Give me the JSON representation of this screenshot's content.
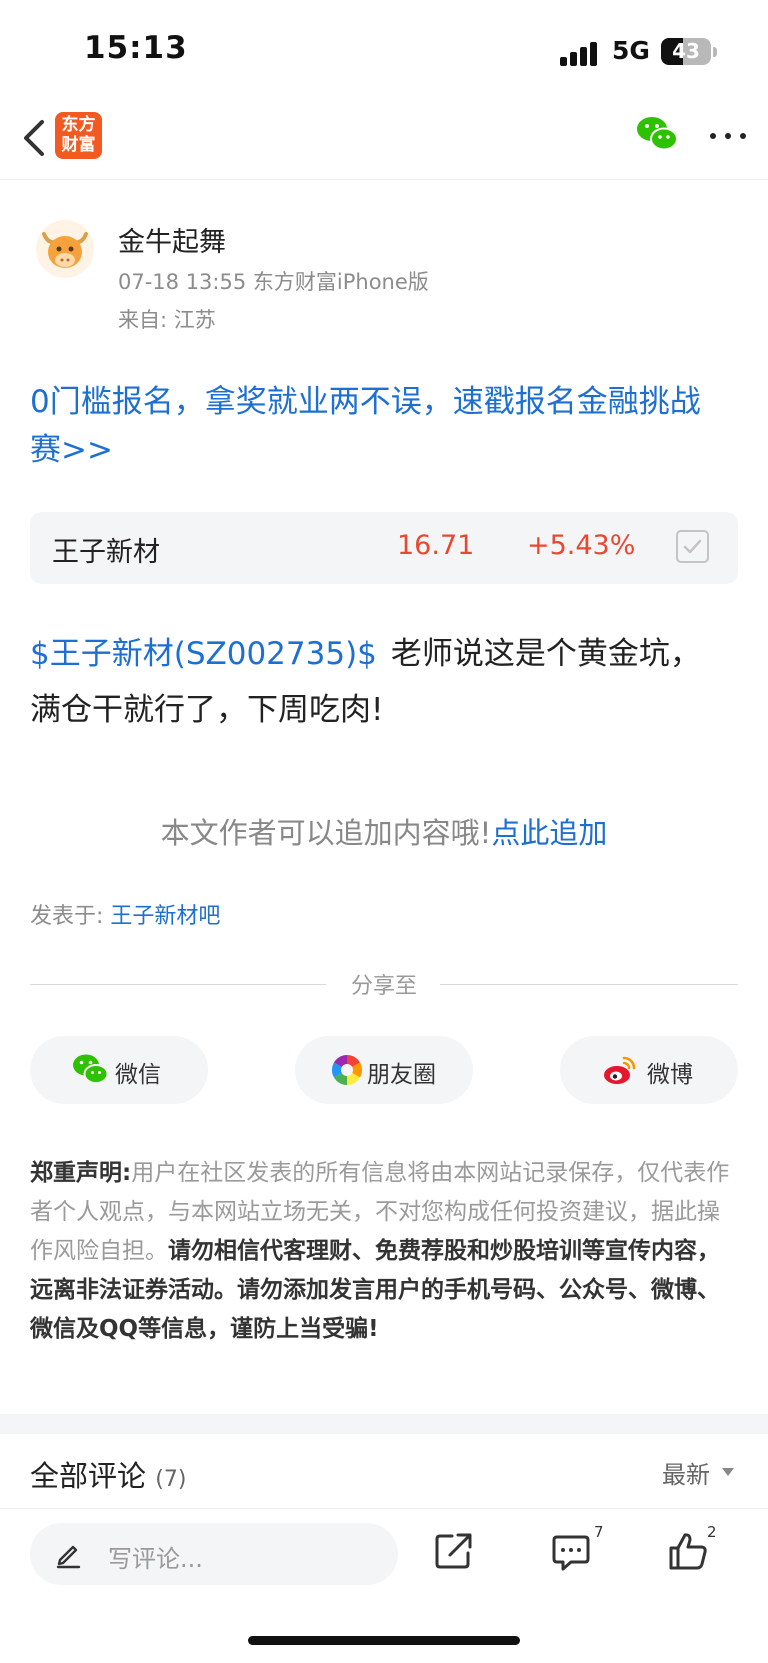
{
  "status_bar": {
    "time": "15:13",
    "network": "5G",
    "battery_level": "43",
    "signal_icon": "signal-bars-icon"
  },
  "nav": {
    "back_icon": "chevron-left-icon",
    "logo_line1": "东方",
    "logo_line2": "财富",
    "share_icon": "wechat-icon",
    "more_icon": "more-dots-icon"
  },
  "author": {
    "name": "金牛起舞",
    "meta": "07-18 13:55 东方财富iPhone版",
    "location": "来自: 江苏",
    "avatar_icon": "bull-avatar-icon"
  },
  "promo": {
    "text": "0门槛报名，拿奖就业两不误，速戳报名金融挑战赛>>"
  },
  "stock": {
    "name": "王子新材",
    "price": "16.71",
    "change": "+5.43%",
    "add_icon": "checkbox-icon"
  },
  "post": {
    "mention": "$王子新材(SZ002735)$",
    "body": "老师说这是个黄金坑，满仓干就行了，下周吃肉!"
  },
  "append": {
    "prompt": "本文作者可以追加内容哦!",
    "link": "点此追加"
  },
  "posted_in": {
    "label": "发表于: ",
    "bar": "王子新材吧"
  },
  "share": {
    "label": "分享至",
    "items": [
      {
        "label": "微信",
        "icon": "wechat-icon"
      },
      {
        "label": "朋友圈",
        "icon": "moments-icon"
      },
      {
        "label": "微博",
        "icon": "weibo-icon"
      }
    ]
  },
  "disclaimer": {
    "title": "郑重声明:",
    "normal": "用户在社区发表的所有信息将由本网站记录保存，仅代表作者个人观点，与本网站立场无关，不对您构成任何投资建议，据此操作风险自担。",
    "warning": "请勿相信代客理财、免费荐股和炒股培训等宣传内容，远离非法证券活动。请勿添加发言用户的手机号码、公众号、微博、微信及QQ等信息，谨防上当受骗!"
  },
  "comments": {
    "title": "全部评论",
    "count": "(7)",
    "sort": "最新"
  },
  "bottom_bar": {
    "placeholder": "写评论...",
    "comment_count": "7",
    "like_count": "2",
    "icons": [
      "pen-icon",
      "share-out-icon",
      "comment-icon",
      "thumbs-up-icon"
    ]
  },
  "colors": {
    "link_blue": "#1d6fd1",
    "rise_red": "#e9482f",
    "brand_orange": "#f25a22"
  }
}
